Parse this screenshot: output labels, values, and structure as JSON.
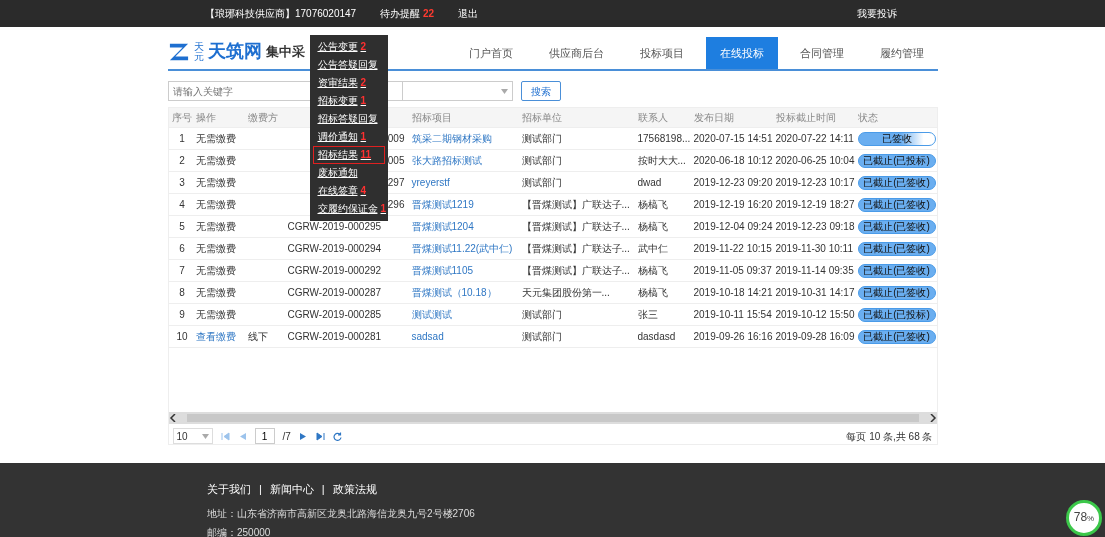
{
  "topbar": {
    "account": "【琅琊科技供应商】17076020147",
    "todo_label": "待办提醒",
    "todo_count": "22",
    "logout": "退出",
    "complaint": "我要投诉"
  },
  "todo_menu": [
    {
      "label": "公告变更",
      "count": "2",
      "selected": false
    },
    {
      "label": "公告答疑回复",
      "selected": false
    },
    {
      "label": "资审结果",
      "count": "2",
      "selected": false
    },
    {
      "label": "招标变更",
      "count": "1",
      "selected": false
    },
    {
      "label": "招标答疑回复",
      "selected": false
    },
    {
      "label": "调价通知",
      "count": "1",
      "selected": false
    },
    {
      "label": "招标结果",
      "count": "11",
      "selected": true
    },
    {
      "label": "废标通知",
      "selected": false
    },
    {
      "label": "在线签章",
      "count": "4",
      "selected": false
    },
    {
      "label": "交履约保证金",
      "count": "1",
      "selected": false
    }
  ],
  "logo": {
    "small": "天元",
    "name": "天筑网",
    "subtitle": "集中采"
  },
  "nav": [
    {
      "label": "门户首页",
      "selected": false
    },
    {
      "label": "供应商后台",
      "selected": false
    },
    {
      "label": "投标项目",
      "selected": false
    },
    {
      "label": "在线投标",
      "selected": true
    },
    {
      "label": "合同管理",
      "selected": false
    },
    {
      "label": "履约管理",
      "selected": false
    }
  ],
  "search": {
    "placeholder": "请输入关键字",
    "button": "搜索"
  },
  "table": {
    "columns": [
      "序号",
      "操作",
      "缴费方",
      "招标项目",
      "招标单位",
      "联系人",
      "发布日期",
      "投标截止时间",
      "状态"
    ],
    "rows": [
      {
        "no": "1",
        "op": "无需缴费",
        "op_link": false,
        "code": "009",
        "project": "筑采二期钢材采购",
        "unit": "测试部门",
        "contact": "17568198...",
        "published": "2020-07-15 14:51",
        "deadline": "2020-07-22 14:11",
        "status": "已签收",
        "kind": "partial"
      },
      {
        "no": "2",
        "op": "无需缴费",
        "op_link": false,
        "code": "005",
        "project": "张大路招标测试",
        "unit": "测试部门",
        "contact": "按时大大...",
        "published": "2020-06-18 10:12",
        "deadline": "2020-06-25 10:04",
        "status": "已截止(已投标)",
        "kind": "full"
      },
      {
        "no": "3",
        "op": "无需缴费",
        "op_link": false,
        "code": "297",
        "project": "yreyerstf",
        "unit": "测试部门",
        "contact": "dwad",
        "published": "2019-12-23 09:20",
        "deadline": "2019-12-23 10:17",
        "status": "已截止(已签收)",
        "kind": "full"
      },
      {
        "no": "4",
        "op": "无需缴费",
        "op_link": false,
        "code": "296",
        "project": "晋煤测试1219",
        "unit": "【晋煤测试】广联达子...",
        "contact": "杨槁飞",
        "published": "2019-12-19 16:20",
        "deadline": "2019-12-19 18:27",
        "status": "已截止(已签收)",
        "kind": "full"
      },
      {
        "no": "5",
        "op": "无需缴费",
        "op_link": false,
        "code": "CGRW-2019-000295",
        "project": "晋煤测试1204",
        "unit": "【晋煤测试】广联达子...",
        "contact": "杨槁飞",
        "published": "2019-12-04 09:24",
        "deadline": "2019-12-23 09:18",
        "status": "已截止(已签收)",
        "kind": "full"
      },
      {
        "no": "6",
        "op": "无需缴费",
        "op_link": false,
        "code": "CGRW-2019-000294",
        "project": "晋煤测试11.22(武中仁)",
        "unit": "【晋煤测试】广联达子...",
        "contact": "武中仁",
        "published": "2019-11-22 10:15",
        "deadline": "2019-11-30 10:11",
        "status": "已截止(已签收)",
        "kind": "full"
      },
      {
        "no": "7",
        "op": "无需缴费",
        "op_link": false,
        "code": "CGRW-2019-000292",
        "project": "晋煤测试1105",
        "unit": "【晋煤测试】广联达子...",
        "contact": "杨槁飞",
        "published": "2019-11-05 09:37",
        "deadline": "2019-11-14 09:35",
        "status": "已截止(已签收)",
        "kind": "full"
      },
      {
        "no": "8",
        "op": "无需缴费",
        "op_link": false,
        "code": "CGRW-2019-000287",
        "project": "晋煤测试（10.18）",
        "unit": "天元集团股份第一...",
        "contact": "杨槁飞",
        "published": "2019-10-18 14:21",
        "deadline": "2019-10-31 14:17",
        "status": "已截止(已签收)",
        "kind": "full"
      },
      {
        "no": "9",
        "op": "无需缴费",
        "op_link": false,
        "code": "CGRW-2019-000285",
        "project": "测试测试",
        "unit": "测试部门",
        "contact": "张三",
        "published": "2019-10-11 15:54",
        "deadline": "2019-10-12 15:50",
        "status": "已截止(已投标)",
        "kind": "full"
      },
      {
        "no": "10",
        "op": "查看缴费",
        "op_link": true,
        "pay": "线下",
        "code": "CGRW-2019-000281",
        "project": "sadsad",
        "unit": "测试部门",
        "contact": "dasdasd",
        "published": "2019-09-26 16:16",
        "deadline": "2019-09-28 16:09",
        "status": "已截止(已签收)",
        "kind": "full"
      }
    ]
  },
  "pager": {
    "page_size": "10",
    "page": "1",
    "total_pages": "/7",
    "summary": "每页 10 条,共 68 条"
  },
  "footer": {
    "links": [
      "关于我们",
      "新闻中心",
      "政策法规"
    ],
    "separator": "|",
    "address": "地址：山东省济南市高新区龙奥北路海信龙奥九号2号楼2706",
    "postcode": "邮编：250000"
  },
  "speed_badge": {
    "value": "78",
    "unit": "%"
  }
}
